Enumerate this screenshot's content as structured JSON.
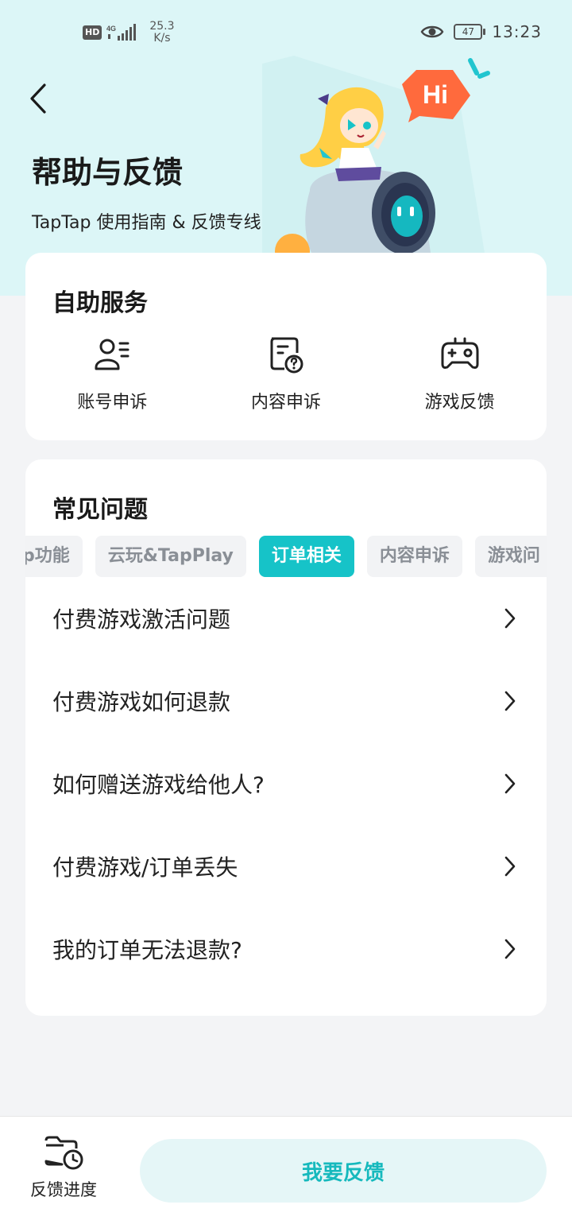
{
  "status_bar": {
    "hd": "HD",
    "network": "4G",
    "speed_value": "25.3",
    "speed_unit": "K/s",
    "battery": "47",
    "time": "13:23"
  },
  "header": {
    "title": "帮助与反馈",
    "subtitle": "TapTap 使用指南 & 反馈专线",
    "mascot_bubble": "Hi"
  },
  "self_service": {
    "title": "自助服务",
    "items": [
      {
        "label": "账号申诉",
        "icon": "account-icon"
      },
      {
        "label": "内容申诉",
        "icon": "content-question-icon"
      },
      {
        "label": "游戏反馈",
        "icon": "gamepad-icon"
      }
    ]
  },
  "faq": {
    "title": "常见问题",
    "tabs": [
      {
        "label": "p功能"
      },
      {
        "label": "云玩&TapPlay"
      },
      {
        "label": "订单相关",
        "active": true
      },
      {
        "label": "内容申诉"
      },
      {
        "label": "游戏问"
      }
    ],
    "items": [
      "付费游戏激活问题",
      "付费游戏如何退款",
      "如何赠送游戏给他人?",
      "付费游戏/订单丢失",
      "我的订单无法退款?"
    ]
  },
  "bottom_bar": {
    "progress_label": "反馈进度",
    "feedback_button": "我要反馈"
  },
  "colors": {
    "accent": "#16c3c8",
    "hero_background": "#dcf6f7",
    "page_background": "#f3f4f6"
  }
}
